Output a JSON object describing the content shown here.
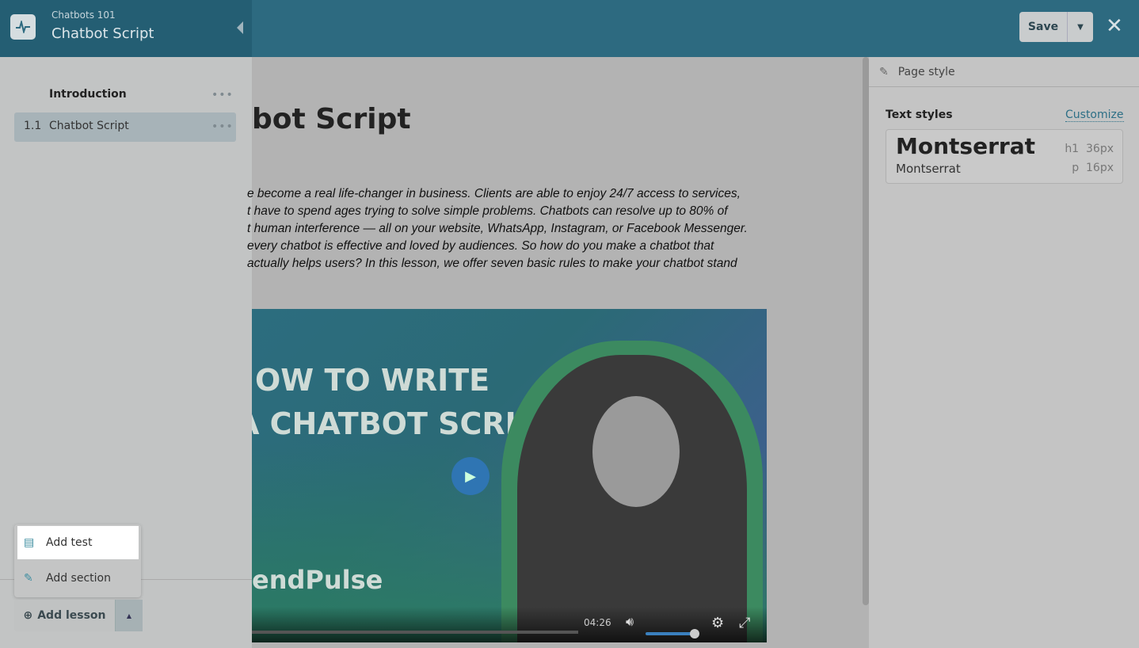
{
  "header": {
    "course": "Chatbots 101",
    "title": "Chatbot Script",
    "save_label": "Save",
    "logo_icon": "pulse-icon",
    "close_icon": "close-icon"
  },
  "sidebar": {
    "section": "Introduction",
    "lessons": [
      {
        "number": "1.1",
        "title": "Chatbot Script"
      }
    ],
    "menu": [
      {
        "label": "Add test",
        "icon": "test-icon"
      },
      {
        "label": "Add section",
        "icon": "edit-icon"
      }
    ],
    "add_lesson": "Add lesson"
  },
  "content": {
    "heading": "bot Script",
    "paragraph": [
      "e become a real life-changer in business. Clients are able to enjoy 24/7 access to services,",
      "t have to spend ages trying to solve simple problems. Chatbots can resolve up to 80% of",
      "t human interference — all on your website, WhatsApp, Instagram, or Facebook Messenger.",
      "every chatbot is effective and loved by audiences. So how do you make a chatbot that",
      "actually helps users? In this lesson, we offer seven basic rules to make your chatbot stand"
    ],
    "video": {
      "title_line1": "OW TO WRITE",
      "title_line2": "A CHATBOT SCRIPT",
      "brand": "endPulse",
      "time": "04:26",
      "volume_percent": 85
    }
  },
  "right_panel": {
    "page_style": "Page style",
    "text_styles": "Text styles",
    "customize": "Customize",
    "heading_font": "Montserrat",
    "heading_tag": "h1",
    "heading_size": "36px",
    "body_font": "Montserrat",
    "body_tag": "p",
    "body_size": "16px"
  },
  "colors": {
    "header": "#2d6a80",
    "accent": "#3d8da0"
  }
}
